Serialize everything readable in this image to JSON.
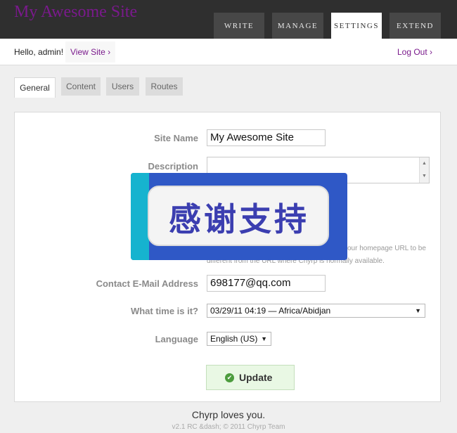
{
  "header": {
    "site_title": "My Awesome Site",
    "nav": [
      {
        "label": "WRITE"
      },
      {
        "label": "MANAGE"
      },
      {
        "label": "SETTINGS",
        "active": true
      },
      {
        "label": "EXTEND"
      }
    ]
  },
  "userbar": {
    "hello": "Hello, admin!",
    "view_site": "View Site ›",
    "logout": "Log Out ›"
  },
  "subtabs": [
    {
      "label": "General",
      "active": true
    },
    {
      "label": "Content"
    },
    {
      "label": "Users"
    },
    {
      "label": "Routes"
    }
  ],
  "form": {
    "site_name_label": "Site Name",
    "site_name_value": "My Awesome Site",
    "description_label": "Description",
    "description_value": "",
    "url_hint_line1": "our homepage URL to be",
    "url_hint_line2": "different from the URL where Chyrp is normally available.",
    "email_label": "Contact E-Mail Address",
    "email_value": "698177@qq.com",
    "time_label": "What time is it?",
    "time_value": "03/29/11 04:19 — Africa/Abidjan",
    "language_label": "Language",
    "language_value": "English (US)",
    "update_label": "Update"
  },
  "overlay": {
    "text": "感谢支持"
  },
  "footer": {
    "main": "Chyrp loves you.",
    "sub": "v2.1 RC &dash; © 2011 Chyrp Team"
  },
  "colors": {
    "accent": "#7a1a8c",
    "topbar": "#2f2f2f",
    "update_bg": "#e9f8e4"
  }
}
